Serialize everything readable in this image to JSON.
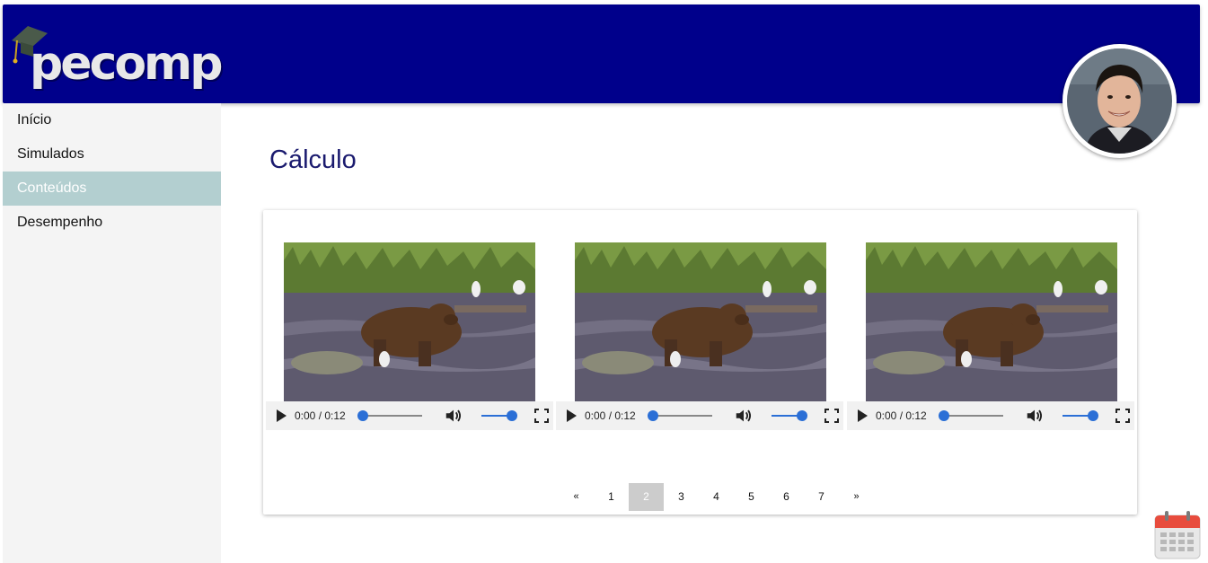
{
  "header": {
    "logo_text": "pecomp",
    "colors": {
      "bar": "#00008b",
      "logo": "#e8e8e8"
    }
  },
  "sidebar": {
    "items": [
      {
        "label": "Início",
        "active": false
      },
      {
        "label": "Simulados",
        "active": false
      },
      {
        "label": "Conteúdos",
        "active": true
      },
      {
        "label": "Desempenho",
        "active": false
      }
    ],
    "active_color": "#b3cfd0"
  },
  "main": {
    "title": "Cálculo",
    "videos": [
      {
        "time": "0:00 / 0:12",
        "progress": 0.0,
        "volume": 1.0
      },
      {
        "time": "0:00 / 0:12",
        "progress": 0.0,
        "volume": 1.0
      },
      {
        "time": "0:00 / 0:12",
        "progress": 0.0,
        "volume": 1.0
      }
    ],
    "pagination": {
      "prev": "«",
      "pages": [
        "1",
        "2",
        "3",
        "4",
        "5",
        "6",
        "7"
      ],
      "current": "2",
      "next": "»"
    }
  },
  "icons": {
    "avatar": "user-avatar",
    "calendar": "calendar-icon",
    "play": "play-icon",
    "volume": "volume-icon",
    "fullscreen": "fullscreen-icon"
  }
}
